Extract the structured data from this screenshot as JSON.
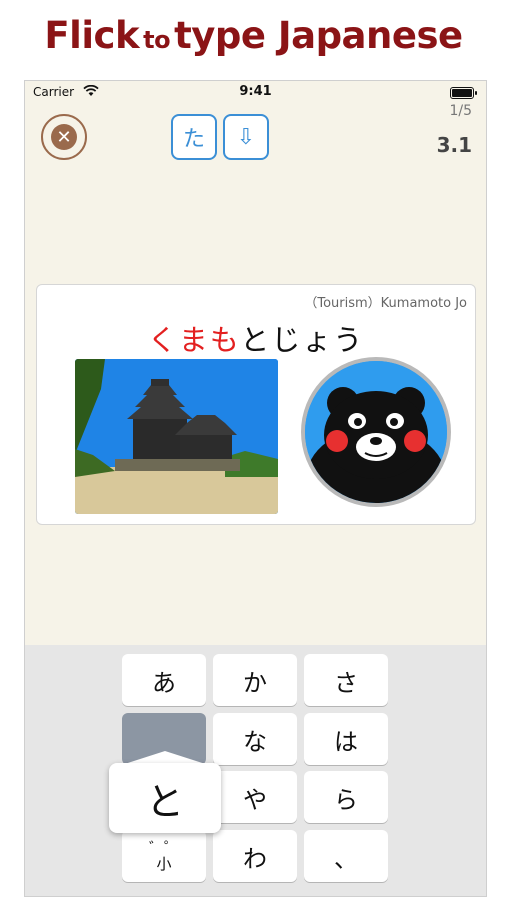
{
  "banner": {
    "part1": "Flick",
    "part2": "to",
    "part3": "type Japanese"
  },
  "status_bar": {
    "carrier": "Carrier",
    "time": "9:41"
  },
  "toolbar": {
    "kana_label": "た",
    "down_label": "⇩",
    "progress": "1/5",
    "score": "3.1"
  },
  "card": {
    "caption": "（Tourism）Kumamoto Jo",
    "typed": "くまも",
    "remaining": "とじょう"
  },
  "keyboard": {
    "rows": [
      [
        "あ",
        "か",
        "さ"
      ],
      [
        "",
        "な",
        "は"
      ],
      [
        "",
        "や",
        "ら"
      ],
      [
        "゛゜\n小",
        "わ",
        "、"
      ]
    ],
    "popup": "と"
  },
  "colors": {
    "typed": "#e32020",
    "accent": "#3b8fd6",
    "banner": "#8b1416",
    "close": "#9a6a4c"
  }
}
